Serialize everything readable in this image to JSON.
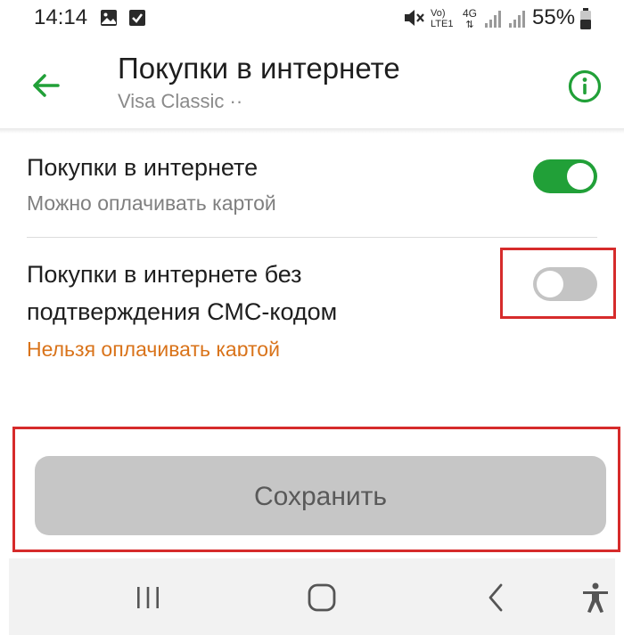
{
  "status_bar": {
    "time": "14:14",
    "network_label": "Vo) LTE1",
    "network_type": "4G",
    "battery_percent": "55%",
    "icons": [
      "gallery-icon",
      "checkbox-notification-icon",
      "mute-icon",
      "volte-icon",
      "signal-icon",
      "signal-icon",
      "battery-icon"
    ]
  },
  "header": {
    "title": "Покупки в интернете",
    "subtitle": "Visa Classic ··",
    "back_icon": "arrow-left-icon",
    "info_icon": "info-icon"
  },
  "settings": [
    {
      "title": "Покупки в интернете",
      "subtitle": "Можно оплачивать картой",
      "enabled": true
    },
    {
      "title_line1": "Покупки в интернете без",
      "title_line2": "подтверждения СМС-кодом",
      "subtitle": "Нельзя оплачивать картой",
      "enabled": false
    }
  ],
  "save_button": {
    "label": "Сохранить"
  },
  "colors": {
    "accent_green": "#21a038",
    "warning_orange": "#d9731a",
    "highlight_red": "#d62b2b",
    "disabled_button": "#c6c6c6"
  },
  "nav_bar": {
    "icons": [
      "recents-icon",
      "home-icon",
      "back-icon",
      "accessibility-icon"
    ]
  }
}
